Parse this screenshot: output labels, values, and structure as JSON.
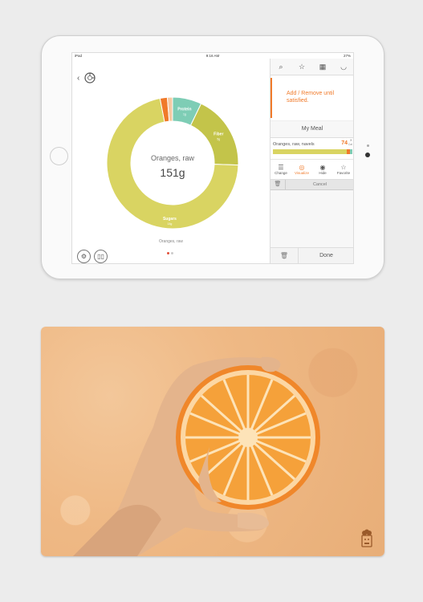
{
  "status": {
    "carrier": "iPad",
    "time": "9:16 AM",
    "battery": "27%"
  },
  "donut": {
    "center_title": "Oranges, raw",
    "center_value": "151g",
    "segments": [
      {
        "name": "Protein",
        "amount": "1g",
        "value": 1.4,
        "color": "#7ecdb5"
      },
      {
        "name": "Fiber",
        "amount": "5g",
        "value": 3.6,
        "color": "#c3c44a"
      },
      {
        "name": "Sugars",
        "amount": "14g",
        "value": 14,
        "color": "#d9d462"
      },
      {
        "name": "",
        "amount": "",
        "value": 0.35,
        "color": "#f07a2a"
      },
      {
        "name": "",
        "amount": "",
        "value": 0.25,
        "color": "#f6c9a3"
      }
    ],
    "caption": "Oranges, raw"
  },
  "panel": {
    "hint": "Add / Remove until satisfied.",
    "meal_title": "My Meal",
    "item": {
      "name": "Oranges, raw, navels",
      "calories": "74",
      "unit": "Cal"
    },
    "nutrient_colors": [
      "#d9d462",
      "#f07a2a",
      "#7ecdb5"
    ],
    "actions": [
      {
        "label": "Change",
        "icon": "☰"
      },
      {
        "label": "Visualize",
        "icon": "◎"
      },
      {
        "label": "Hide",
        "icon": "◉"
      },
      {
        "label": "Favorite",
        "icon": "☆"
      }
    ],
    "cancel": "Cancel",
    "done": "Done"
  },
  "colors": {
    "accent": "#f07a2a",
    "teal": "#7ecdb5",
    "lime": "#d9d462",
    "olive": "#c3c44a"
  }
}
